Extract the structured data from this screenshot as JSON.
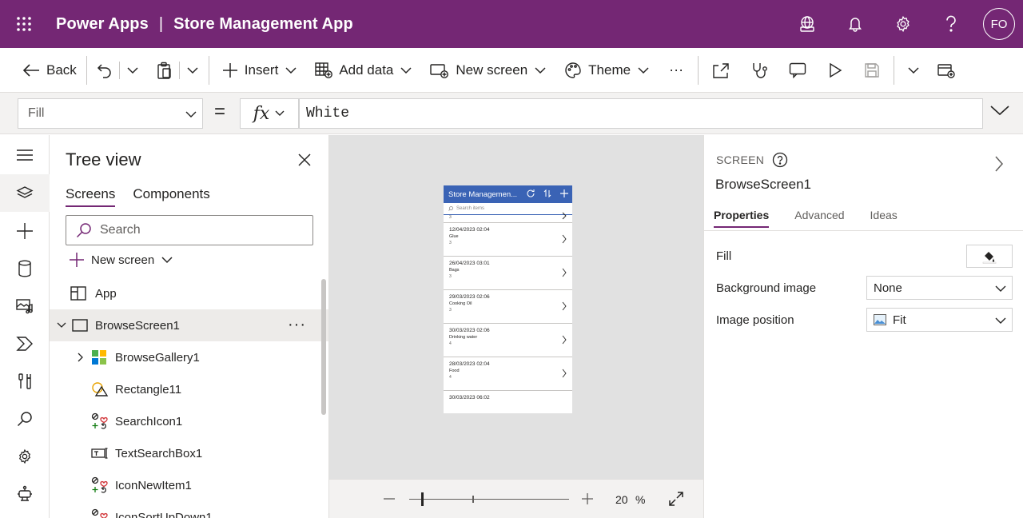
{
  "header": {
    "product": "Power Apps",
    "separator": "|",
    "app_name": "Store Management App",
    "avatar_initials": "FO",
    "brand_color": "#742774"
  },
  "commandbar": {
    "back": "Back",
    "insert": "Insert",
    "add_data": "Add data",
    "new_screen": "New screen",
    "theme": "Theme",
    "more": "···"
  },
  "formula_bar": {
    "property": "Fill",
    "equals": "=",
    "fx": "fx",
    "formula": "White"
  },
  "tree": {
    "title": "Tree view",
    "tabs": [
      "Screens",
      "Components"
    ],
    "search_placeholder": "Search",
    "new_screen": "New screen",
    "items": [
      {
        "label": "App",
        "icon": "app-icon"
      },
      {
        "label": "BrowseScreen1",
        "icon": "screen-icon",
        "selected": true,
        "more": "···"
      },
      {
        "label": "BrowseGallery1",
        "icon": "gallery-icon"
      },
      {
        "label": "Rectangle11",
        "icon": "shapes-icon"
      },
      {
        "label": "SearchIcon1",
        "icon": "icon-control-icon"
      },
      {
        "label": "TextSearchBox1",
        "icon": "text-input-icon"
      },
      {
        "label": "IconNewItem1",
        "icon": "icon-control-icon"
      },
      {
        "label": "IconSortUpDown1",
        "icon": "icon-control-icon"
      }
    ]
  },
  "canvas": {
    "phone_title": "Store Managemen...",
    "phone_search_placeholder": "Search items",
    "header_color": "#3a63b5",
    "top_partial_qty": "3",
    "items": [
      {
        "date": "12/04/2023 02:04",
        "name": "Glue",
        "qty": "3"
      },
      {
        "date": "26/04/2023 03:01",
        "name": "Bags",
        "qty": "3"
      },
      {
        "date": "29/03/2023 02:06",
        "name": "Cooking Oil",
        "qty": "3"
      },
      {
        "date": "30/03/2023 02:06",
        "name": "Drinking water",
        "qty": "4"
      },
      {
        "date": "28/03/2023 02:04",
        "name": "Food",
        "qty": "4"
      },
      {
        "date": "30/03/2023 06:02",
        "name": "",
        "qty": ""
      }
    ],
    "zoom_value": "20",
    "zoom_percent_sign": "%",
    "zoom_level": 0.2
  },
  "right_panel": {
    "type_label": "SCREEN",
    "name": "BrowseScreen1",
    "tabs": [
      "Properties",
      "Advanced",
      "Ideas"
    ],
    "fill_label": "Fill",
    "bg_image_label": "Background image",
    "bg_image_value": "None",
    "image_position_label": "Image position",
    "image_position_value": "Fit"
  }
}
